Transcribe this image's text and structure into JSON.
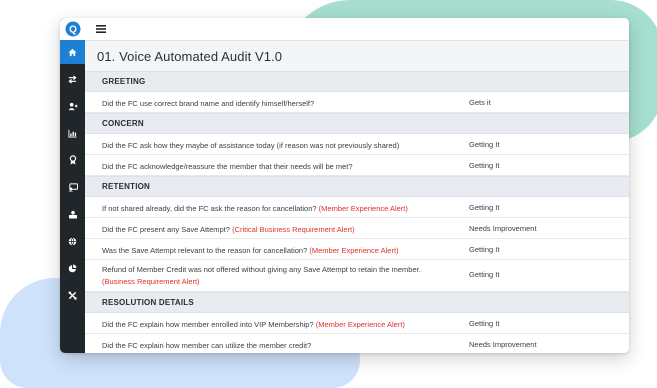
{
  "colors": {
    "sidebar_bg": "#21262b",
    "active_nav": "#1e80d2",
    "section_bg": "#e8ecf1",
    "alert_text": "#e0302d",
    "blob_green": "#a6dfcf",
    "blob_blue": "#cfe2fb"
  },
  "sidebar": {
    "logo": "Q",
    "icons": [
      "home-icon",
      "transfer-icon",
      "users-icon",
      "bar-chart-icon",
      "award-icon",
      "chat-icon",
      "user-card-icon",
      "globe-icon",
      "pie-chart-icon",
      "tools-icon"
    ]
  },
  "header": {
    "title": "01. Voice Automated Audit V1.0"
  },
  "sections": [
    {
      "name": "GREETING",
      "rows": [
        {
          "q": "Did the FC use correct brand name and identify himself/herself?",
          "alert": "",
          "a": "Gets it"
        }
      ]
    },
    {
      "name": "CONCERN",
      "rows": [
        {
          "q": "Did the FC ask how they maybe of assistance today (if reason was not previously shared)",
          "alert": "",
          "a": "Getting It"
        },
        {
          "q": "Did the FC acknowledge/reassure the member that their needs will be met?",
          "alert": "",
          "a": "Getting It"
        }
      ]
    },
    {
      "name": "RETENTION",
      "rows": [
        {
          "q": "If not shared already, did the FC ask the reason for cancellation?",
          "alert": "(Member Experience Alert)",
          "a": "Getting It"
        },
        {
          "q": "Did the FC present any Save Attempt?",
          "alert": "(Critical Business Requirement Alert)",
          "a": "Needs Improvement"
        },
        {
          "q": "Was the Save Attempt relevant to the reason for cancellation?",
          "alert": "(Member Experience Alert)",
          "a": "Getting It"
        },
        {
          "q": "Refund of Member Credit was not offered without giving any Save Attempt to retain the member.",
          "alert": "(Business Requirement Alert)",
          "a": "Getting It",
          "tall": true
        }
      ]
    },
    {
      "name": "RESOLUTION DETAILS",
      "rows": [
        {
          "q": "Did the FC explain how member enrolled into VIP Membership?",
          "alert": "(Member Experience Alert)",
          "a": "Getting It"
        },
        {
          "q": "Did the FC explain how member can utilize the member credit?",
          "alert": "",
          "a": "Needs Improvement"
        }
      ]
    }
  ]
}
